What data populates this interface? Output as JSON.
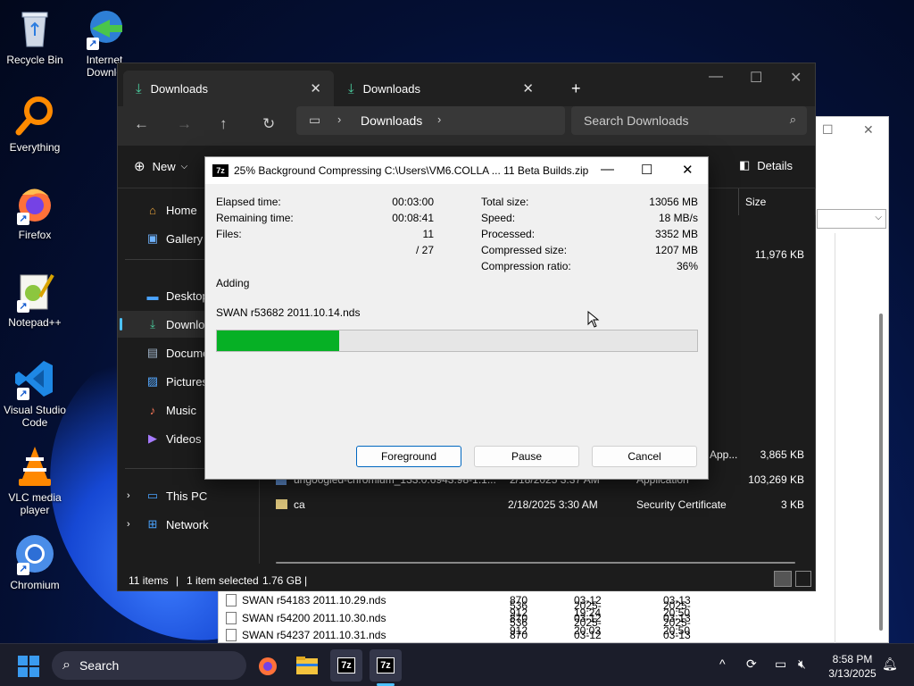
{
  "desktop": {
    "icons": [
      {
        "label": "Recycle Bin",
        "icon": "recycle-bin-icon"
      },
      {
        "label": "Internet Downlo",
        "icon": "internet-download-manager-icon"
      },
      {
        "label": "Everything",
        "icon": "everything-search-icon"
      },
      {
        "label": "Firefox",
        "icon": "firefox-icon"
      },
      {
        "label": "Notepad++",
        "icon": "notepad-plus-plus-icon"
      },
      {
        "label": "Visual Studio Code",
        "icon": "vscode-icon"
      },
      {
        "label": "VLC media player",
        "icon": "vlc-icon"
      },
      {
        "label": "Chromium",
        "icon": "chromium-icon"
      }
    ]
  },
  "background_window": {
    "rows": [
      {
        "name": "SWAN r54183 2011.10.29.nds",
        "size": "536 870 912",
        "modified": "2025-03-12 19:24",
        "created": "2025-03-13 20:50"
      },
      {
        "name": "SWAN r54200 2011.10.30.nds",
        "size": "536 870 912",
        "modified": "2025-03-12 20:03",
        "created": "2025-03-13 20:50"
      },
      {
        "name": "SWAN r54237 2011.10.31.nds",
        "size": "536 870 912",
        "modified": "2025-03-12 20:53",
        "created": "2025-03-13 20:51"
      }
    ]
  },
  "explorer": {
    "tabs": [
      {
        "label": "Downloads"
      },
      {
        "label": "Downloads"
      }
    ],
    "new_tab": "+",
    "address": {
      "path": "Downloads"
    },
    "search_placeholder": "Search Downloads",
    "new_label": "New",
    "details_label": "Details",
    "sidebar": [
      {
        "label": "Home",
        "icon": "home-icon"
      },
      {
        "label": "Gallery",
        "icon": "gallery-icon"
      },
      {
        "label": "Desktop",
        "icon": "desktop-icon"
      },
      {
        "label": "Downloads",
        "icon": "download-icon"
      },
      {
        "label": "Documents",
        "icon": "documents-icon"
      },
      {
        "label": "Pictures",
        "icon": "pictures-icon"
      },
      {
        "label": "Music",
        "icon": "music-icon"
      },
      {
        "label": "Videos",
        "icon": "videos-icon"
      },
      {
        "label": "This PC",
        "icon": "pc-icon"
      },
      {
        "label": "Network",
        "icon": "network-icon"
      }
    ],
    "column_size": "Size",
    "rows": [
      {
        "name": "",
        "date": "",
        "type": "",
        "size": "11,976 KB"
      },
      {
        "name": "",
        "date": "",
        "type": "App...",
        "size": "3,865 KB"
      },
      {
        "name": "ungoogled-chromium_133.0.6943.98-1.1...",
        "date": "2/18/2025 3:37 AM",
        "type": "Application",
        "size": "103,269 KB"
      },
      {
        "name": "ca",
        "date": "2/18/2025 3:30 AM",
        "type": "Security Certificate",
        "size": "3 KB"
      }
    ],
    "status": {
      "items": "11 items",
      "selected": "1 item selected",
      "sel_size": "1.76 GB"
    }
  },
  "zip_dialog": {
    "title": "25% Background Compressing C:\\Users\\VM6.COLLA ... 11 Beta Builds.zip",
    "logo": "7z",
    "elapsed_label": "Elapsed time:",
    "elapsed_value": "00:03:00",
    "remaining_label": "Remaining time:",
    "remaining_value": "00:08:41",
    "files_label": "Files:",
    "files_value": "11",
    "files_total": "/ 27",
    "total_size_label": "Total size:",
    "total_size_value": "13056 MB",
    "speed_label": "Speed:",
    "speed_value": "18 MB/s",
    "processed_label": "Processed:",
    "processed_value": "3352 MB",
    "compressed_label": "Compressed size:",
    "compressed_value": "1207 MB",
    "ratio_label": "Compression ratio:",
    "ratio_value": "36%",
    "status": "Adding",
    "current_file": "SWAN r53682 2011.10.14.nds",
    "progress_fraction": 0.255,
    "buttons": {
      "foreground": "Foreground",
      "pause": "Pause",
      "cancel": "Cancel"
    }
  },
  "taskbar": {
    "search_label": "Search",
    "time": "8:58 PM",
    "date": "3/13/2025"
  }
}
